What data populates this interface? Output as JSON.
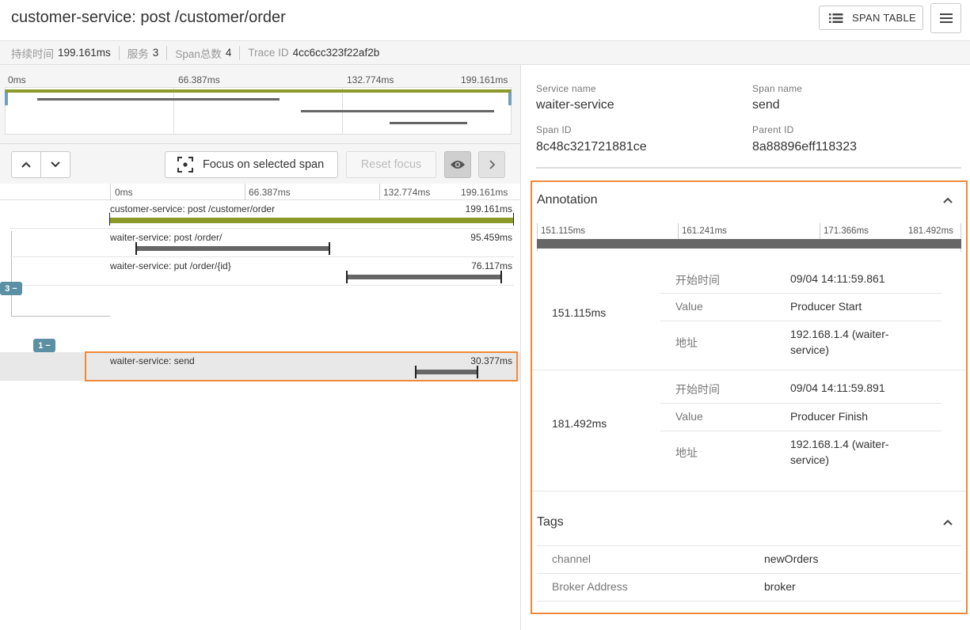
{
  "header": {
    "title": "customer-service: post /customer/order",
    "span_table_label": "SPAN TABLE"
  },
  "infobar": {
    "duration_label": "持续时间",
    "duration_value": "199.161ms",
    "services_label": "服务",
    "services_value": "3",
    "span_count_label": "Span总数",
    "span_count_value": "4",
    "trace_id_label": "Trace ID",
    "trace_id_value": "4cc6cc323f22af2b"
  },
  "minimap": {
    "ticks": [
      "0ms",
      "66.387ms",
      "132.774ms",
      "199.161ms"
    ]
  },
  "controls": {
    "focus_label": "Focus on selected span",
    "reset_label": "Reset focus"
  },
  "timeline": {
    "ticks": [
      "0ms",
      "66.387ms",
      "132.774ms",
      "199.161ms"
    ],
    "total_ms": 199.161,
    "spans": [
      {
        "name": "customer-service: post /customer/order",
        "duration": "199.161ms",
        "start_ms": 0,
        "duration_ms": 199.161,
        "depth": 0
      },
      {
        "name": "waiter-service: post /order/",
        "duration": "95.459ms",
        "start_ms": 13.1,
        "duration_ms": 95.459,
        "depth": 1
      },
      {
        "name": "waiter-service: put /order/{id}",
        "duration": "76.117ms",
        "start_ms": 117.0,
        "duration_ms": 76.117,
        "depth": 1
      },
      {
        "name": "waiter-service: send",
        "duration": "30.377ms",
        "start_ms": 151.115,
        "duration_ms": 30.377,
        "depth": 2,
        "selected": true
      }
    ],
    "badges": [
      "3 −",
      "1 −"
    ]
  },
  "detail": {
    "service_name_label": "Service name",
    "service_name": "waiter-service",
    "span_name_label": "Span name",
    "span_name": "send",
    "span_id_label": "Span ID",
    "span_id": "8c48c321721881ce",
    "parent_id_label": "Parent ID",
    "parent_id": "8a88896eff118323"
  },
  "annotation": {
    "title": "Annotation",
    "ticks": [
      "151.115ms",
      "161.241ms",
      "171.366ms",
      "181.492ms"
    ],
    "entries": [
      {
        "time": "151.115ms",
        "rows": [
          {
            "key": "开始时间",
            "value": "09/04 14:11:59.861"
          },
          {
            "key": "Value",
            "value": "Producer Start"
          },
          {
            "key": "地址",
            "value": "192.168.1.4 (waiter-service)"
          }
        ]
      },
      {
        "time": "181.492ms",
        "rows": [
          {
            "key": "开始时间",
            "value": "09/04 14:11:59.891"
          },
          {
            "key": "Value",
            "value": "Producer Finish"
          },
          {
            "key": "地址",
            "value": "192.168.1.4 (waiter-service)"
          }
        ]
      }
    ]
  },
  "tags": {
    "title": "Tags",
    "items": [
      {
        "key": "channel",
        "value": "newOrders"
      },
      {
        "key": "Broker Address",
        "value": "broker"
      }
    ]
  },
  "colors": {
    "root_bar": "#8c9a2a",
    "span_bar": "#666666",
    "highlight": "#f08a3a",
    "badge": "#5b8fa3"
  }
}
